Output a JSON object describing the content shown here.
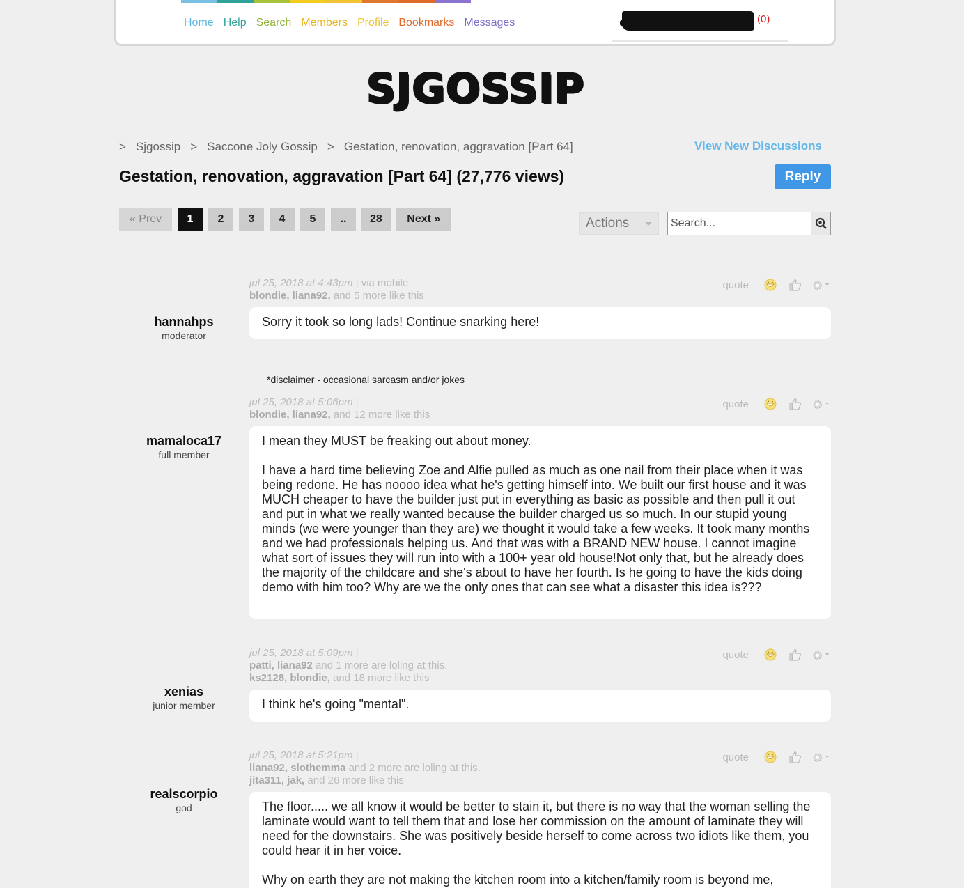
{
  "nav": {
    "items": [
      {
        "label": "Home",
        "color": "#5ab6e0"
      },
      {
        "label": "Help",
        "color": "#35a39a"
      },
      {
        "label": "Search",
        "color": "#8fb23a"
      },
      {
        "label": "Members",
        "color": "#e9b41d"
      },
      {
        "label": "Profile",
        "color": "#f1c232"
      },
      {
        "label": "Bookmarks",
        "color": "#e06a2a"
      },
      {
        "label": "Messages",
        "color": "#7a6fcb"
      }
    ],
    "bar_colors": [
      "#79c0e2",
      "#2fa39a",
      "#a7c53a",
      "#f2cc1e",
      "#f1c232",
      "#e0772e",
      "#e06a2a",
      "#8a74cf"
    ],
    "message_count": "(0)"
  },
  "logo": "SJGOSSIP",
  "breadcrumb": [
    {
      "label": "Sjgossip"
    },
    {
      "label": "Saccone Joly Gossip"
    },
    {
      "label": "Gestation, renovation, aggravation [Part 64]"
    }
  ],
  "breadcrumb_sep": ">",
  "view_new": "View New Discussions",
  "title": "Gestation, renovation, aggravation [Part 64] (27,776 views)",
  "reply_label": "Reply",
  "pager": {
    "prev": "« Prev",
    "pages": [
      "1",
      "2",
      "3",
      "4",
      "5",
      "..",
      "28"
    ],
    "next": "Next »",
    "current": "1"
  },
  "actions_label": "Actions",
  "search": {
    "placeholder": "Search..."
  },
  "quote_label": "quote",
  "disclaimer": "*disclaimer - occasional sarcasm and/or jokes",
  "posts": [
    {
      "author": "hannahps",
      "role": "moderator",
      "date": "jul 25, 2018 at 4:43pm",
      "via": "|  via mobile",
      "likes_names": "blondie, liana92,",
      "likes_rest": " and 5 more like this",
      "lol_names": "",
      "lol_rest": "",
      "body": [
        "Sorry it took so long lads! Continue snarking here!"
      ]
    },
    {
      "author": "mamaloca17",
      "role": "full member",
      "date": "jul 25, 2018 at 5:06pm",
      "via": "|",
      "likes_names": "blondie, liana92,",
      "likes_rest": " and 12 more like this",
      "lol_names": "",
      "lol_rest": "",
      "body": [
        "I mean they MUST be freaking out about money.",
        "I have a hard time believing Zoe and Alfie pulled as much as one nail from their place when it was being redone. He has noooo idea what he's getting himself into. We built our first house and it was MUCH cheaper to have the builder just put in everything as basic as possible and then pull it out and put in what we really wanted because the builder charged us so much. In our stupid young minds (we were younger than they are) we thought it would take a few weeks. It took many months and we had professionals helping us. And that was with a BRAND NEW house. I cannot imagine what sort of issues they will run into with a 100+ year old house!Not only that, but he already does the majority of the childcare and she's about to have her fourth. Is he going to have the kids doing demo with him too? Why are we the only ones that can see what a disaster this idea is???"
      ]
    },
    {
      "author": "xenias",
      "role": "junior member",
      "date": "jul 25, 2018 at 5:09pm",
      "via": "|",
      "lol_names": "patti, liana92",
      "lol_rest": " and 1 more are loling at this.",
      "likes_names": "ks2128, blondie,",
      "likes_rest": " and 18 more like this",
      "body": [
        "I think he's going \"mental\"."
      ]
    },
    {
      "author": "realscorpio",
      "role": "god",
      "date": "jul 25, 2018 at 5:21pm",
      "via": "|",
      "lol_names": "liana92, slothemma",
      "lol_rest": " and 2 more are loling at this.",
      "likes_names": "jita311, jak,",
      "likes_rest": " and 26 more like this",
      "body": [
        "The floor..... we all know it would be better to stain it, but there is no way that the woman selling the laminate would want to tell them that and lose her commission on the amount of laminate they will need for the downstairs. She was positively beside herself to come across two idiots like them, you could hear it in her voice.",
        "Why on earth they are not making the kitchen room into a kitchen/family room is beyond me,"
      ]
    }
  ]
}
